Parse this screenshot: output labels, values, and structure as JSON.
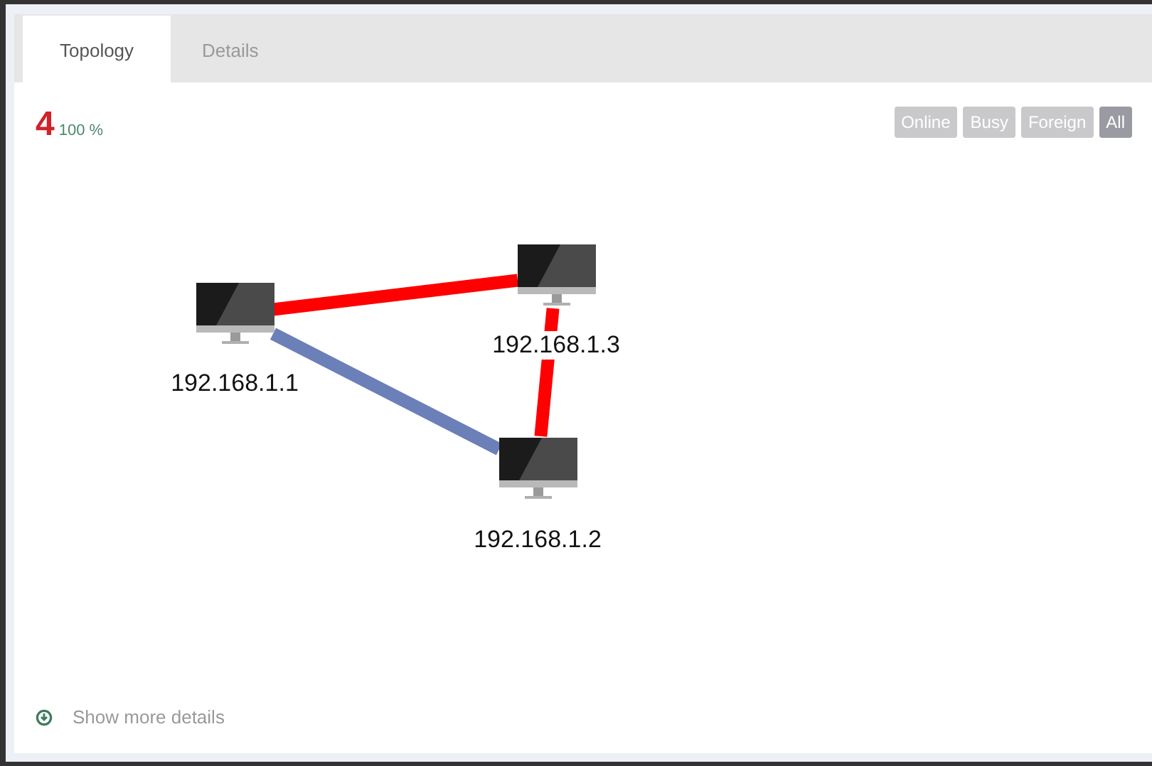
{
  "tabs": [
    {
      "label": "Topology",
      "selected": true
    },
    {
      "label": "Details",
      "selected": false
    }
  ],
  "summary": {
    "count": "4",
    "percent": "100 %"
  },
  "filters": [
    {
      "label": "Online",
      "selected": false
    },
    {
      "label": "Busy",
      "selected": false
    },
    {
      "label": "Foreign",
      "selected": false
    },
    {
      "label": "All",
      "selected": true
    }
  ],
  "topology": {
    "nodes": [
      {
        "label": "192.168.1.1"
      },
      {
        "label": "192.168.1.2"
      },
      {
        "label": "192.168.1.3"
      }
    ],
    "edges": [
      {
        "color": "#ff0000"
      },
      {
        "color": "#ff0000"
      },
      {
        "color": "#6b7fb8"
      }
    ]
  },
  "footer": {
    "link": "Show more details"
  }
}
